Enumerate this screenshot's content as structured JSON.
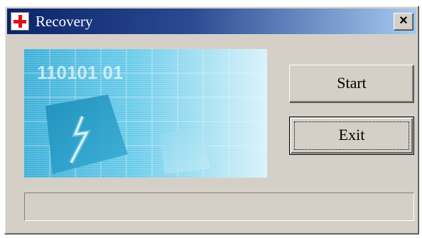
{
  "window": {
    "title": "Recovery",
    "close_label": "×"
  },
  "buttons": {
    "start_label": "Start",
    "exit_label": "Exit"
  },
  "banner": {
    "digits": "110101 01"
  },
  "progress": {
    "value": 0
  },
  "colors": {
    "titlebar_start": "#0a246a",
    "titlebar_end": "#a6caf0",
    "face": "#d4d0c8",
    "icon_cross": "#e0101a",
    "banner_cyan": "#5fc4e2"
  },
  "icons": [
    "red-cross-app-icon",
    "close-icon"
  ]
}
